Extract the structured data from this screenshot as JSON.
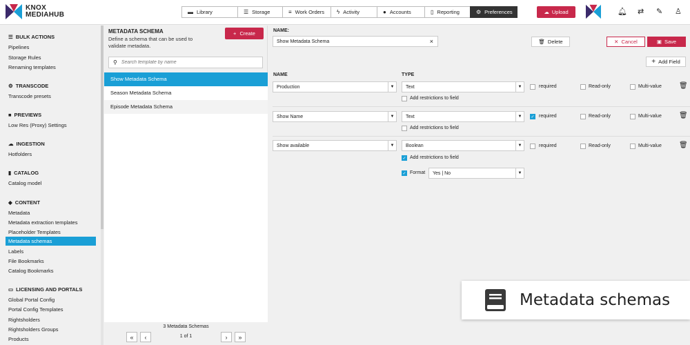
{
  "app": {
    "logo_line1": "KNOX",
    "logo_line2": "MEDIAHUB"
  },
  "nav": [
    {
      "label": "Library",
      "icon": "folder-icon",
      "active": false
    },
    {
      "label": "Storage",
      "icon": "database-icon",
      "active": false
    },
    {
      "label": "Work Orders",
      "icon": "list-icon",
      "active": false
    },
    {
      "label": "Activity",
      "icon": "bolt-icon",
      "active": false
    },
    {
      "label": "Accounts",
      "icon": "user-icon",
      "active": false
    },
    {
      "label": "Reporting",
      "icon": "document-icon",
      "active": false
    },
    {
      "label": "Preferences",
      "icon": "gear-icon",
      "active": true
    }
  ],
  "header": {
    "upload_label": "Upload"
  },
  "sidebar": {
    "sections": [
      {
        "title": "BULK ACTIONS",
        "icon": "list-icon",
        "items": [
          "Pipelines",
          "Storage Rules",
          "Renaming templates"
        ]
      },
      {
        "title": "TRANSCODE",
        "icon": "cogs-icon",
        "items": [
          "Transcode presets"
        ]
      },
      {
        "title": "PREVIEWS",
        "icon": "video-icon",
        "items": [
          "Low Res (Proxy) Settings"
        ]
      },
      {
        "title": "INGESTION",
        "icon": "cloud-upload-icon",
        "items": [
          "Hotfolders"
        ]
      },
      {
        "title": "CATALOG",
        "icon": "book-icon",
        "items": [
          "Catalog model"
        ]
      },
      {
        "title": "CONTENT",
        "icon": "tag-icon",
        "items": [
          "Metadata",
          "Metadata extraction templates",
          "Placeholder Templates",
          "Metadata schemas",
          "Labels",
          "File Bookmarks",
          "Catalog Bookmarks"
        ]
      },
      {
        "title": "LICENSING AND PORTALS",
        "icon": "monitor-icon",
        "items": [
          "Global Portal Config",
          "Portal Config Templates",
          "Rightsholders",
          "Rightsholders Groups",
          "Products"
        ]
      }
    ],
    "active_item": "Metadata schemas"
  },
  "middle": {
    "title": "METADATA SCHEMA",
    "description": "Define a schema that can be used to validate metadata.",
    "create_label": "Create",
    "search_placeholder": "Search template by name",
    "items": [
      "Show Metadata Schema",
      "Season Metadata Schema",
      "Episode Metadata Schema"
    ],
    "selected": "Show Metadata Schema",
    "count_text": "3 Metadata Schemas",
    "page_text": "1 of 1"
  },
  "editor": {
    "name_label": "NAME:",
    "name_value": "Show Metadata Schema",
    "delete_label": "Delete",
    "cancel_label": "Cancel",
    "save_label": "Save",
    "add_field_label": "Add Field",
    "col_name": "NAME",
    "col_type": "TYPE",
    "required_label": "required",
    "readonly_label": "Read-only",
    "multivalue_label": "Multi-value",
    "restrict_label": "Add restrictions to field",
    "format_label": "Format",
    "fields": [
      {
        "name": "Production",
        "type": "Text",
        "required": false,
        "read_only": false,
        "multi_value": false,
        "restrictions": false
      },
      {
        "name": "Show Name",
        "type": "Text",
        "required": true,
        "read_only": false,
        "multi_value": false,
        "restrictions": false
      },
      {
        "name": "Show available",
        "type": "Boolean",
        "required": false,
        "read_only": false,
        "multi_value": false,
        "restrictions": true,
        "format_enabled": true,
        "format_value": "Yes | No"
      }
    ]
  },
  "overlay": {
    "text": "Metadata schemas",
    "icon": "book-icon"
  },
  "colors": {
    "accent": "#c8284b",
    "selection": "#1a9fd6",
    "nav_active": "#333333"
  }
}
